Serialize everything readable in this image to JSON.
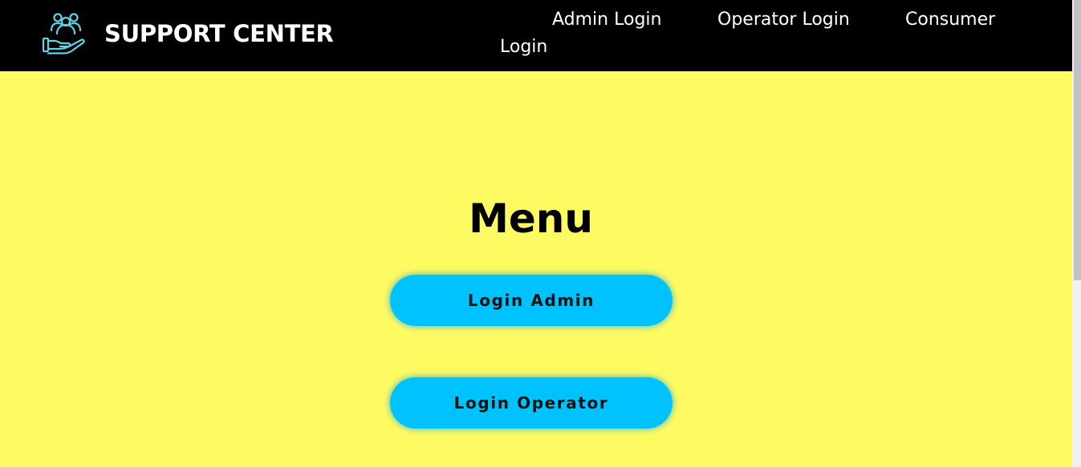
{
  "header": {
    "brand_title": "SUPPORT CENTER",
    "logo_icon": "support-hand-people-icon",
    "nav": {
      "admin_login": "Admin Login",
      "operator_login": "Operator Login",
      "consumer_login_line1": "Consumer",
      "consumer_login_line2": "Login"
    }
  },
  "main": {
    "title": "Menu",
    "buttons": {
      "login_admin": "Login Admin",
      "login_operator": "Login Operator"
    }
  },
  "colors": {
    "navbar_background": "#000000",
    "page_background": "#fefb62",
    "button_background": "#00c2ff",
    "logo_accent": "#5fd3e6"
  }
}
